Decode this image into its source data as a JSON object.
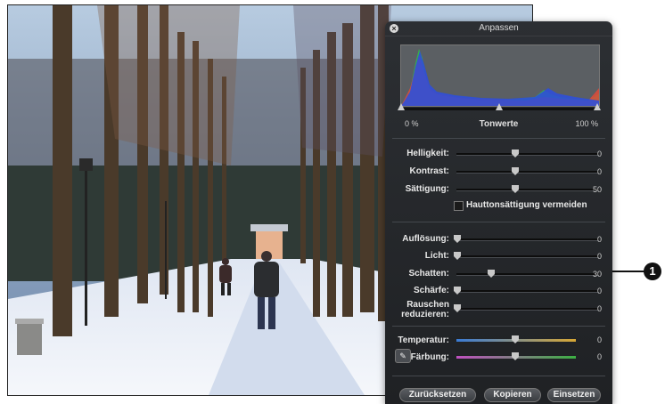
{
  "window": {
    "title": "Anpassen",
    "close_icon": "close-icon"
  },
  "levels": {
    "label_left": "0 %",
    "label_center": "Tonwerte",
    "label_right": "100 %"
  },
  "group_basic": [
    {
      "label": "Helligkeit:",
      "value": "0"
    },
    {
      "label": "Kontrast:",
      "value": "0"
    },
    {
      "label": "Sättigung:",
      "value": "50"
    }
  ],
  "skin_checkbox": {
    "label": "Hauttonsättigung vermeiden",
    "checked": false
  },
  "group_detail": [
    {
      "label": "Auflösung:",
      "value": "0"
    },
    {
      "label": "Licht:",
      "value": "0"
    },
    {
      "label": "Schatten:",
      "value": "30"
    },
    {
      "label": "Schärfe:",
      "value": "0"
    },
    {
      "label": "Rauschen reduzieren:",
      "value": "0"
    }
  ],
  "group_color": [
    {
      "label": "Temperatur:",
      "value": "0"
    },
    {
      "label": "Färbung:",
      "value": "0"
    }
  ],
  "buttons": {
    "reset": "Zurücksetzen",
    "copy": "Kopieren",
    "paste": "Einsetzen"
  },
  "callout": {
    "number": "1"
  },
  "colors": {
    "panel": "#24272a",
    "histogram_blue": "#2f4fd8",
    "histogram_green": "#36b04a",
    "histogram_red": "#e04a3a"
  }
}
